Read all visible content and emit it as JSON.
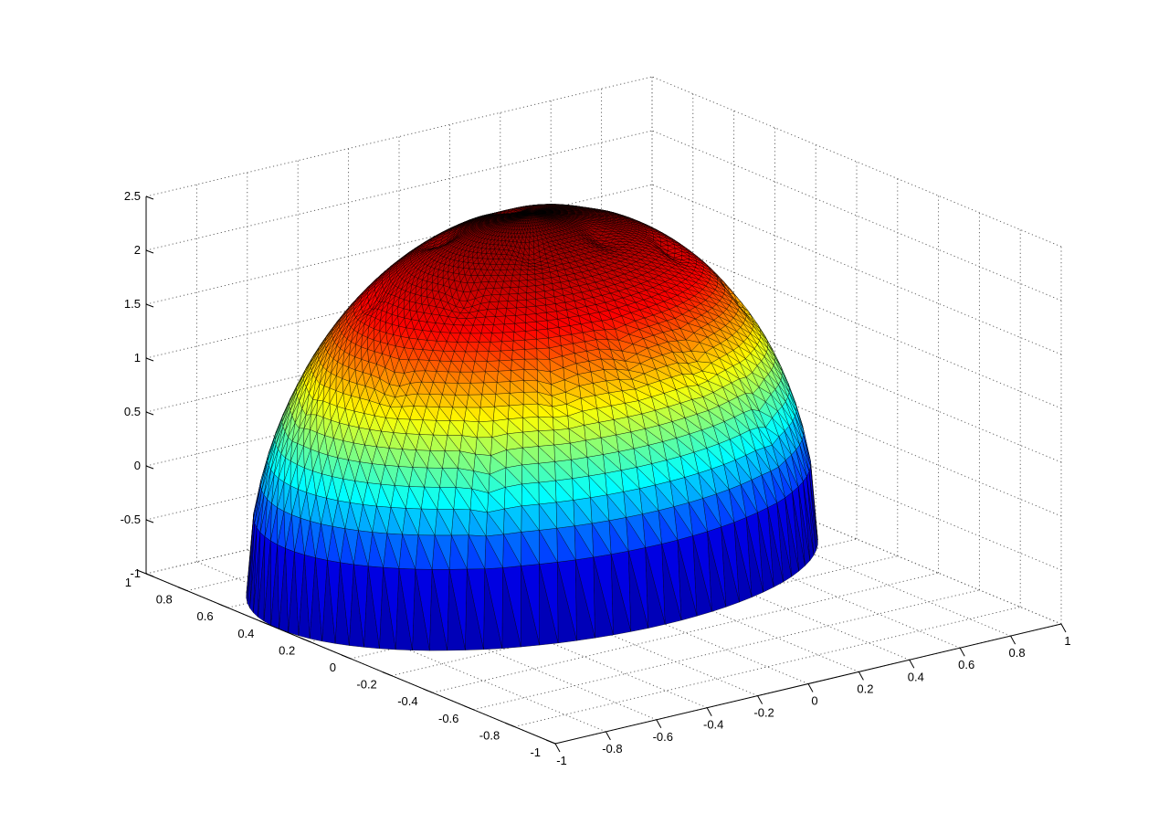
{
  "chart_data": {
    "type": "surface",
    "title": "",
    "xlabel": "",
    "ylabel": "",
    "zlabel": "",
    "xlim": [
      -1,
      1
    ],
    "ylim": [
      -1,
      1
    ],
    "zlim": [
      -1,
      2.5
    ],
    "x_ticks": [
      {
        "value": -1,
        "label": "-1"
      },
      {
        "value": -0.8,
        "label": "-0.8"
      },
      {
        "value": -0.6,
        "label": "-0.6"
      },
      {
        "value": -0.4,
        "label": "-0.4"
      },
      {
        "value": -0.2,
        "label": "-0.2"
      },
      {
        "value": 0,
        "label": "0"
      },
      {
        "value": 0.2,
        "label": "0.2"
      },
      {
        "value": 0.4,
        "label": "0.4"
      },
      {
        "value": 0.6,
        "label": "0.6"
      },
      {
        "value": 0.8,
        "label": "0.8"
      },
      {
        "value": 1,
        "label": "1"
      }
    ],
    "y_ticks": [
      {
        "value": -1,
        "label": "-1"
      },
      {
        "value": -0.8,
        "label": "-0.8"
      },
      {
        "value": -0.6,
        "label": "-0.6"
      },
      {
        "value": -0.4,
        "label": "-0.4"
      },
      {
        "value": -0.2,
        "label": "-0.2"
      },
      {
        "value": 0,
        "label": "0"
      },
      {
        "value": 0.2,
        "label": "0.2"
      },
      {
        "value": 0.4,
        "label": "0.4"
      },
      {
        "value": 0.6,
        "label": "0.6"
      },
      {
        "value": 0.8,
        "label": "0.8"
      },
      {
        "value": 1,
        "label": "1"
      }
    ],
    "z_ticks": [
      {
        "value": -1,
        "label": "-1"
      },
      {
        "value": -0.5,
        "label": "-0.5"
      },
      {
        "value": 0,
        "label": "0"
      },
      {
        "value": 0.5,
        "label": "0.5"
      },
      {
        "value": 1,
        "label": "1"
      },
      {
        "value": 1.5,
        "label": "1.5"
      },
      {
        "value": 2,
        "label": "2"
      },
      {
        "value": 2.5,
        "label": "2.5"
      }
    ],
    "grid": true,
    "box": "open-3d",
    "colormap": "jet",
    "colormap_stops": [
      "#00008f",
      "#0000ff",
      "#00ffff",
      "#ffff00",
      "#ff0000",
      "#800000"
    ],
    "edge_color": "#000000",
    "surface": {
      "mesh": "triangulated",
      "domain": "elliptic region over x in [-1, 1], y in [-0.3, 1]",
      "z_min": -1,
      "z_max": 2.3,
      "features": "regularly spaced small dimples on the surface"
    }
  }
}
